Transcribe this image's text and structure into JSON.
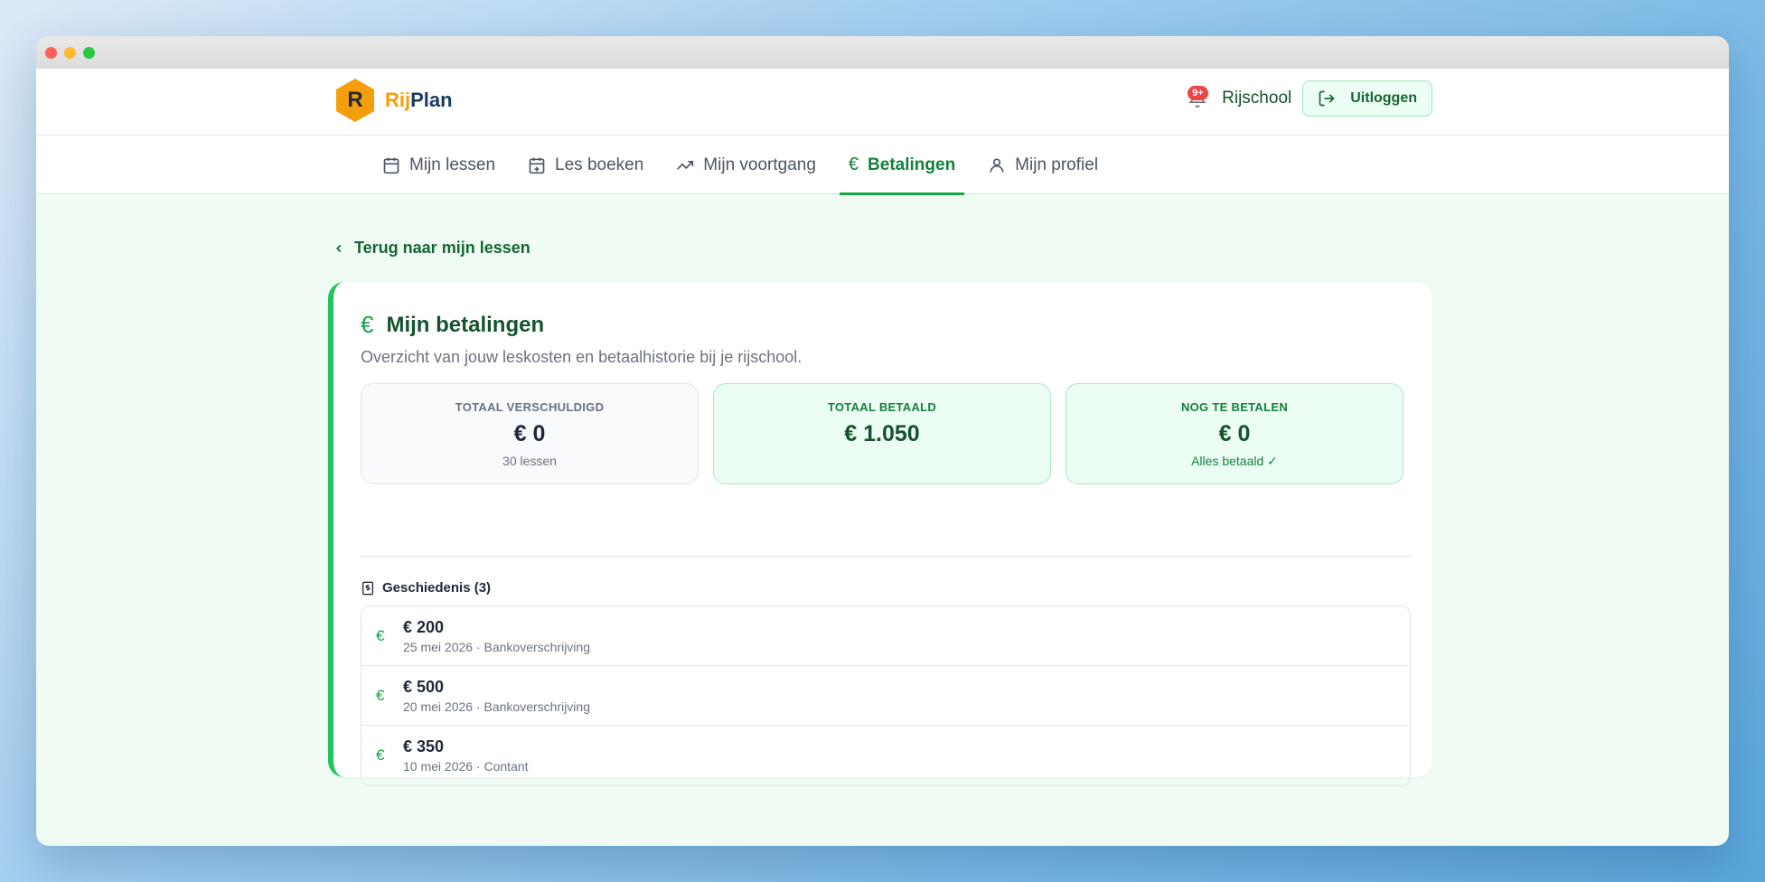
{
  "brand": {
    "logo_letter": "R",
    "name_a": "Rij",
    "name_b": "Plan",
    "logo_color": "#f59e0b"
  },
  "header": {
    "notification_badge": "9+",
    "school_name": "Rijschool",
    "logout_label": "Uitloggen"
  },
  "tabs": [
    {
      "label": "Mijn lessen",
      "icon": "calendar-icon"
    },
    {
      "label": "Les boeken",
      "icon": "calendar-plus-icon"
    },
    {
      "label": "Mijn voortgang",
      "icon": "trending-up-icon"
    },
    {
      "label": "Betalingen",
      "icon": "euro-icon",
      "active": true
    },
    {
      "label": "Mijn profiel",
      "icon": "user-icon"
    }
  ],
  "back_link": "Terug naar mijn lessen",
  "page": {
    "title": "Mijn betalingen",
    "subtitle": "Overzicht van jouw leskosten en betaalhistorie bij je rijschool."
  },
  "stats": [
    {
      "label": "TOTAAL VERSCHULDIGD",
      "value": "€ 0",
      "note": "30 lessen"
    },
    {
      "label": "TOTAAL BETAALD",
      "value": "€ 1.050",
      "note": ""
    },
    {
      "label": "NOG TE BETALEN",
      "value": "€ 0",
      "note": "Alles betaald ✓"
    }
  ],
  "history": {
    "title": "Geschiedenis (3)",
    "items": [
      {
        "amount": "€ 200",
        "meta": "25 mei 2026 · Bankoverschrijving"
      },
      {
        "amount": "€ 500",
        "meta": "20 mei 2026 · Bankoverschrijving"
      },
      {
        "amount": "€ 350",
        "meta": "10 mei 2026 · Contant"
      }
    ]
  },
  "colors": {
    "accent": "#16a34a",
    "background": "#effbf3",
    "badge": "#ef4444"
  }
}
